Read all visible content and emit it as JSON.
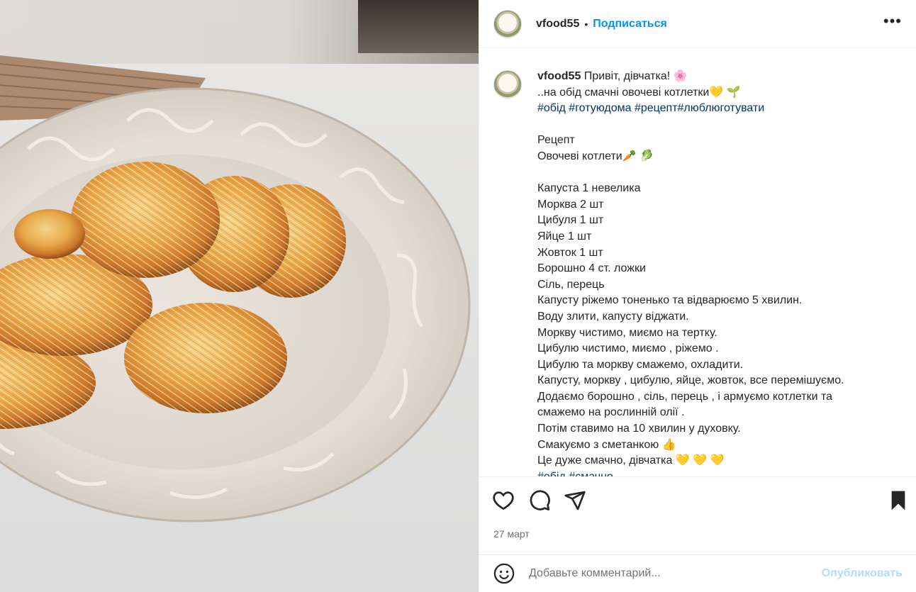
{
  "post": {
    "username": "vfood55",
    "follow_label": "Подписаться",
    "separator": "•",
    "more_label": "•••",
    "image_alt": "Овочеві котлети на тарілці"
  },
  "caption": {
    "username": "vfood55",
    "greeting": " Привіт, дівчатка! 🌸",
    "line2": "..на обід смачні овочеві котлетки💛 🌱",
    "hashtags": "#обід #готуюдома #рецепт#люблюготувати",
    "body": [
      "",
      "Рецепт",
      "Овочеві котлети🥕 🥬",
      "",
      "Капуста 1 невелика",
      "Морква 2 шт",
      "Цибуля 1 шт",
      "Яйце 1 шт",
      "Жовток 1 шт",
      "Борошно 4 ст. ложки",
      "Сіль, перець",
      "Капусту ріжемо тоненько та відварюємо 5 хвилин.",
      "Воду злити, капусту віджати.",
      "Моркву чистимо, миємо на тертку.",
      "Цибулю чистимо, миємо , ріжемо .",
      "Цибулю та моркву смажемо, охладити.",
      "Капусту, моркву , цибулю, яйце, жовток, все перемішуємо.",
      "Додаємо борошно , сіль, перець , і армуємо котлетки та",
      "смажемо на рослинній олії .",
      "Потім ставимо на 10 хвилин у духовку.",
      "Смакуємо з сметанкою 👍",
      "Це дуже смачно, дівчатка 💛 💛 💛"
    ],
    "trailing_hashtags": "#обід #смачно"
  },
  "actions": {
    "like_icon": "heart-icon",
    "comment_icon": "comment-icon",
    "share_icon": "share-icon",
    "save_icon": "bookmark-icon"
  },
  "date": "27 март",
  "comment": {
    "placeholder": "Добавьте комментарий...",
    "publish_label": "Опубликовать",
    "emoji_icon": "emoji-icon"
  }
}
